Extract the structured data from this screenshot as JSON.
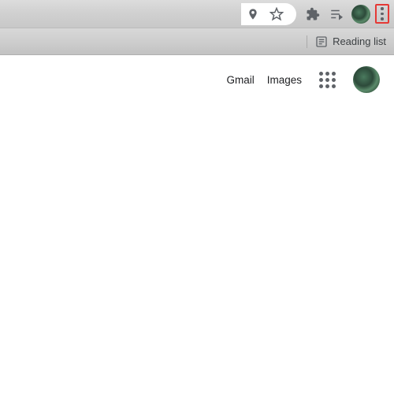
{
  "bookmarks": {
    "reading_list_label": "Reading list"
  },
  "content": {
    "gmail_label": "Gmail",
    "images_label": "Images"
  }
}
